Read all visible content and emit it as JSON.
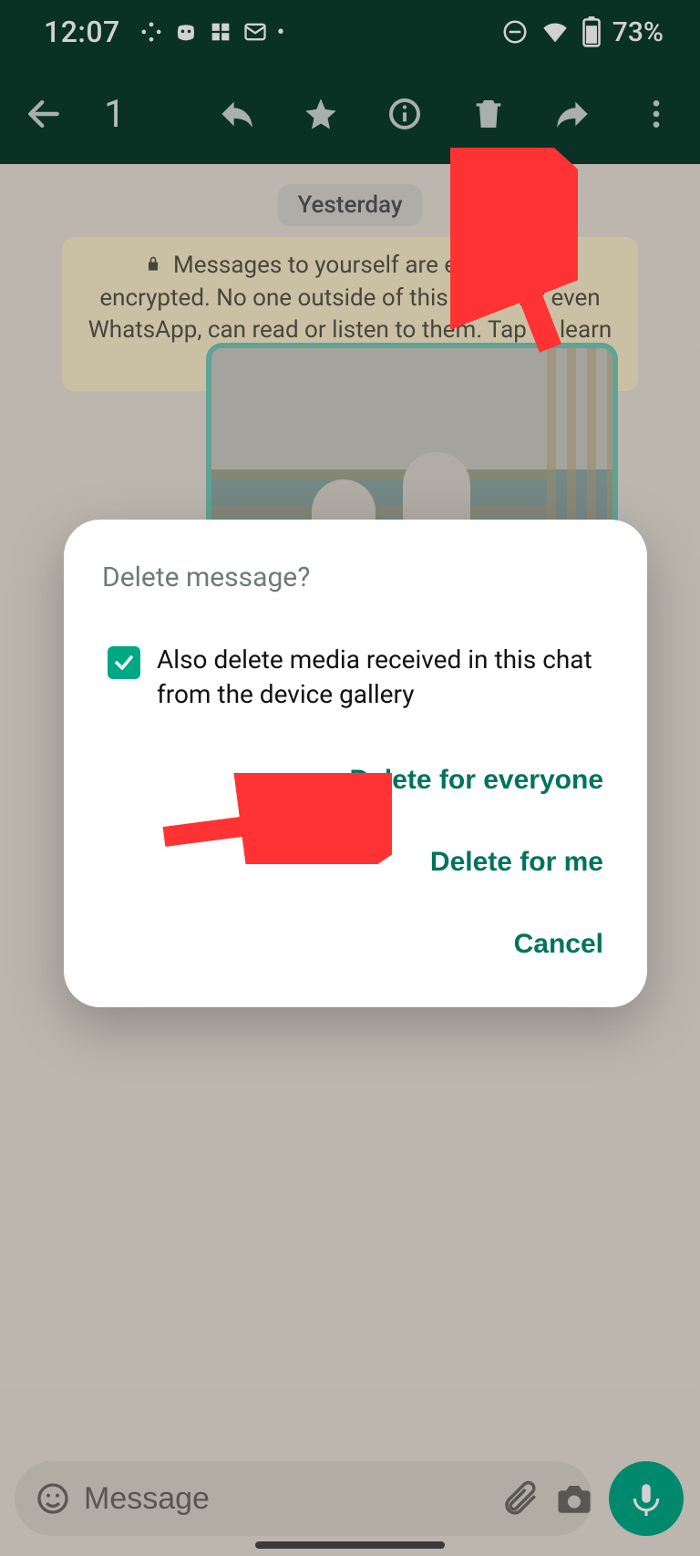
{
  "status": {
    "time": "12:07",
    "dnd_icon": "dnd",
    "wifi_icon": "wifi",
    "battery_percent": "73%"
  },
  "action_bar": {
    "selected_count": "1"
  },
  "chat": {
    "date_chip": "Yesterday",
    "encryption_notice": "Messages to yourself are end-to-end encrypted. No one outside of this chat, not even WhatsApp, can read or listen to them. Tap to learn more."
  },
  "dialog": {
    "title": "Delete message?",
    "checkbox_label": "Also delete media received in this chat from the device gallery",
    "action_delete_everyone": "Delete for everyone",
    "action_delete_me": "Delete for me",
    "action_cancel": "Cancel"
  },
  "compose": {
    "placeholder": "Message"
  }
}
